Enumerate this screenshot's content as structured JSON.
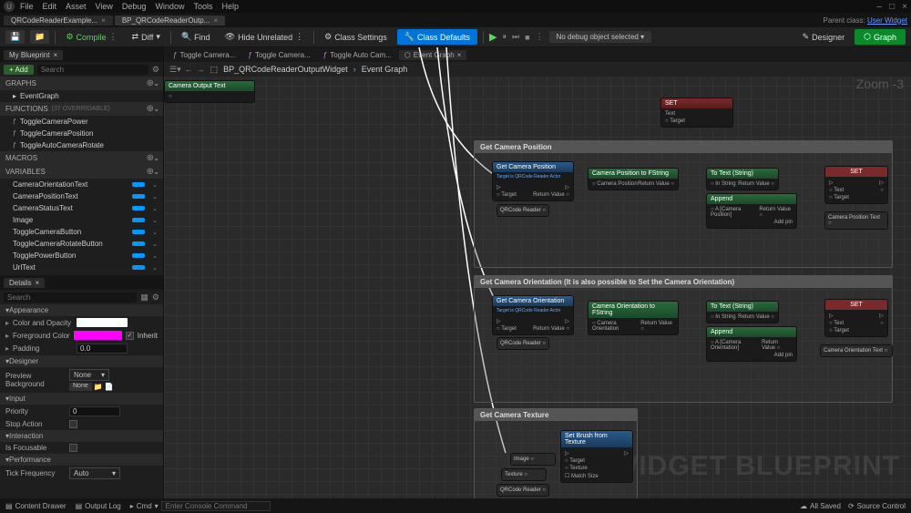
{
  "menu": [
    "File",
    "Edit",
    "Asset",
    "View",
    "Debug",
    "Window",
    "Tools",
    "Help"
  ],
  "fileTabs": [
    {
      "label": "QRCodeReaderExample...",
      "active": false
    },
    {
      "label": "BP_QRCodeReaderOutp...",
      "active": true
    }
  ],
  "parentClass": {
    "label": "Parent class:",
    "link": "User Widget"
  },
  "toolbar": {
    "compile": "Compile",
    "diff": "Diff",
    "find": "Find",
    "hideUnrelated": "Hide Unrelated",
    "classSettings": "Class Settings",
    "classDefaults": "Class Defaults",
    "debugCombo": "No debug object selected",
    "designer": "Designer",
    "graph": "Graph"
  },
  "leftPanel": {
    "tab": "My Blueprint",
    "addLabel": "Add",
    "searchPlaceholder": "Search",
    "sections": {
      "graphs": "GRAPHS",
      "graphsItems": [
        "EventGraph"
      ],
      "functions": "FUNCTIONS",
      "functionsNote": "(37 OVERRIDABLE)",
      "functionsItems": [
        "ToggleCameraPower",
        "ToggleCameraPosition",
        "ToggleAutoCameraRotate"
      ],
      "macros": "MACROS",
      "variables": "VARIABLES",
      "variableItems": [
        "CameraOrientationText",
        "CameraPositionText",
        "CameraStatusText",
        "Image",
        "ToggleCameraButton",
        "ToggleCameraRotateButton",
        "TogglePowerButton",
        "UrlText"
      ]
    },
    "detailsTab": "Details",
    "detailsSearch": "Search",
    "details": {
      "appearance": "Appearance",
      "colorOpacity": "Color and Opacity",
      "foreground": "Foreground Color",
      "inherit": "Inherit",
      "padding": "Padding",
      "paddingVal": "0.0",
      "designer": "Designer",
      "previewBg": "Preview Background",
      "none": "None",
      "input": "Input",
      "priority": "Priority",
      "priorityVal": "0",
      "stopAction": "Stop Action",
      "interaction": "Interaction",
      "focusable": "Is Focusable",
      "performance": "Performance",
      "tickFreq": "Tick Frequency",
      "tickVal": "Auto"
    }
  },
  "canvasTabs": [
    {
      "label": "Toggle Camera..."
    },
    {
      "label": "Toggle Camera..."
    },
    {
      "label": "Toggle Auto Cam..."
    },
    {
      "label": "Event Graph",
      "active": true
    }
  ],
  "breadcrumb": {
    "widget": "BP_QRCodeReaderOutputWidget",
    "graph": "Event Graph"
  },
  "zoom": "Zoom -3",
  "watermark": "WIDGET BLUEPRINT",
  "comments": {
    "pos": "Get Camera Position",
    "orient": "Get Camera Orientation (It is also possible to Set the Camera Orientation)",
    "tex": "Get Camera Texture"
  },
  "nodes": {
    "getCamPos": "Get Camera Position",
    "getCamPosSub": "Target is QRCode Reader Actor",
    "qrReader": "QRCode Reader",
    "target": "Target",
    "returnVal": "Return Value",
    "camPosToStr": "Camera Position to FString",
    "camPos": "Camera Position",
    "toText": "To Text (String)",
    "inString": "In String",
    "append": "Append",
    "a": "A",
    "camPosLit": "Camera Position",
    "addPin": "Add pin",
    "set": "SET",
    "text": "Text",
    "camPosText": "Camera Position Text",
    "getCamOrient": "Get Camera Orientation",
    "camOrientToStr": "Camera Orientation to FString",
    "camOrient": "Camera Orientation",
    "camOrientLit": "Camera Orientation",
    "camOrientText": "Camera Orientation Text",
    "getCamTex": "Get Camera Texture",
    "setBrush": "Set Brush from Texture",
    "image": "Image",
    "texture": "Texture",
    "matchSize": "Match Size",
    "cameraOutput": "Camera Output Text"
  },
  "statusbar": {
    "contentDrawer": "Content Drawer",
    "outputLog": "Output Log",
    "cmd": "Cmd",
    "cmdPlaceholder": "Enter Console Command",
    "allSaved": "All Saved",
    "sourceControl": "Source Control"
  }
}
